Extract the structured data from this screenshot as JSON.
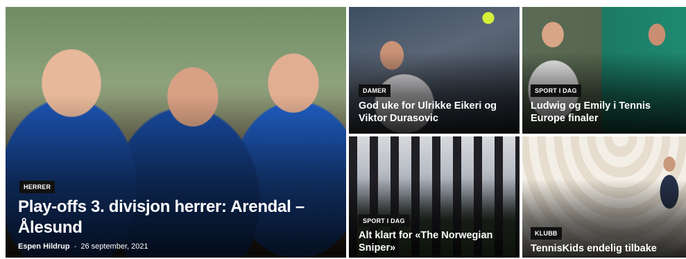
{
  "articles": [
    {
      "category": "HERRER",
      "title": "Play-offs 3. divisjon herrer: Arendal – Ålesund",
      "author": "Espen Hildrup",
      "separator": "-",
      "date": "26 september, 2021"
    },
    {
      "category": "DAMER",
      "title": "God uke for Ulrikke Eikeri og Viktor Durasovic"
    },
    {
      "category": "SPORT I DAG",
      "title": "Ludwig og Emily i Tennis Europe finaler"
    },
    {
      "category": "SPORT I DAG",
      "title": "Alt klart for «The Norwegian Sniper»"
    },
    {
      "category": "KLUBB",
      "title": "TennisKids endelig tilbake"
    }
  ],
  "colors": {
    "tag_background": "#111111",
    "headline_text": "#ffffff"
  }
}
